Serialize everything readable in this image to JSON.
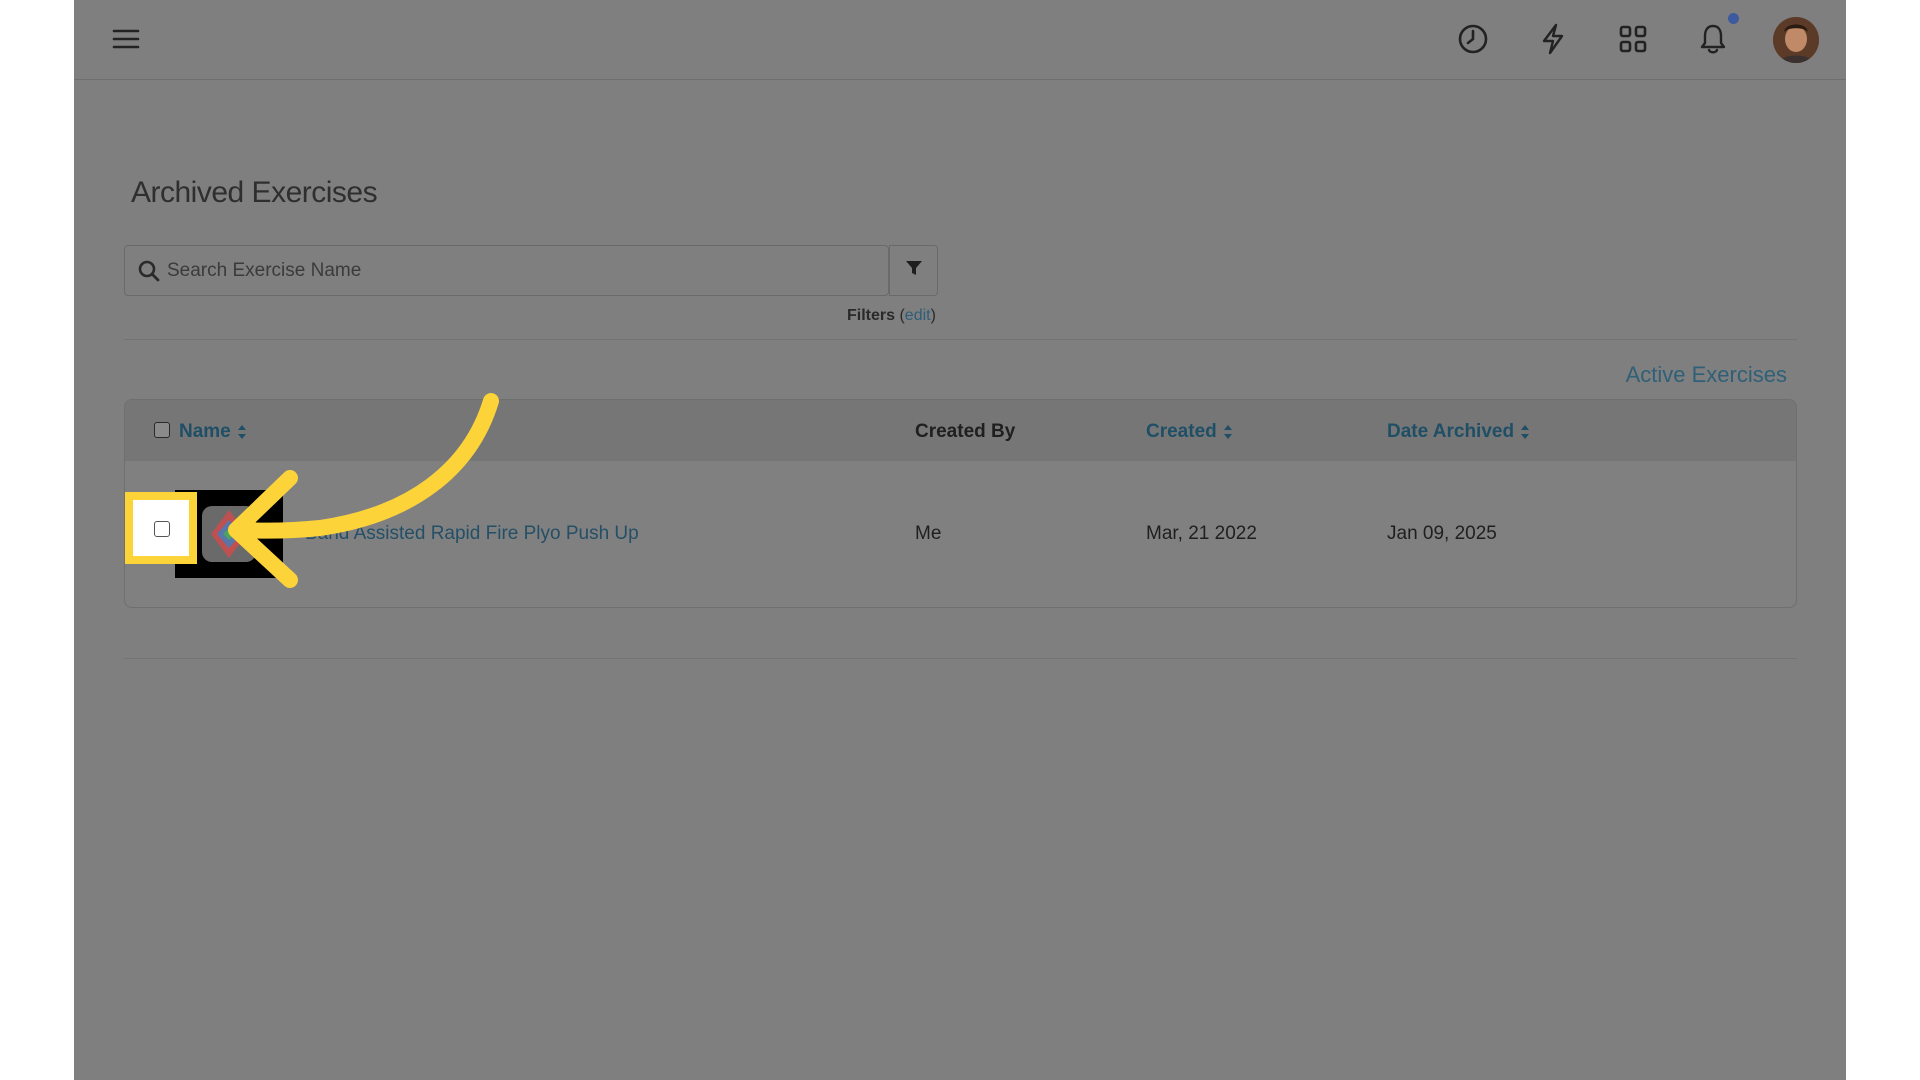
{
  "page": {
    "title": "Archived Exercises"
  },
  "search": {
    "placeholder": "Search Exercise Name",
    "value": ""
  },
  "filters": {
    "label": "Filters",
    "edit_label": "edit"
  },
  "links": {
    "active_exercises": "Active Exercises"
  },
  "table": {
    "columns": {
      "name": "Name",
      "created_by": "Created By",
      "created": "Created",
      "date_archived": "Date Archived"
    },
    "rows": [
      {
        "name": "Band Assisted Rapid Fire Plyo Push Up",
        "created_by": "Me",
        "created": "Mar, 21 2022",
        "date_archived": "Jan 09, 2025"
      }
    ]
  },
  "colors": {
    "overlay": "#7f7f7f",
    "accent_link": "#2f6077",
    "highlight": "#fdd33a",
    "notification_dot": "#3d5a9e"
  },
  "icons": {
    "menu": "hamburger-icon",
    "history": "clock-icon",
    "quick_actions": "lightning-icon",
    "apps": "grid-icon",
    "notifications": "bell-icon",
    "search": "search-icon",
    "filter": "filter-icon"
  }
}
